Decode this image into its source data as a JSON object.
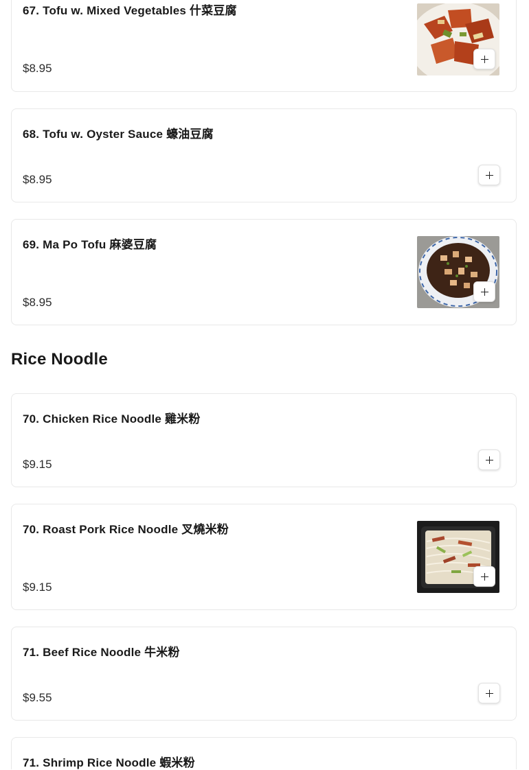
{
  "section": {
    "title": "Rice Noodle"
  },
  "items": [
    {
      "name": "67. Tofu w. Mixed Vegetables 什菜豆腐",
      "price": "$8.95",
      "add_label": "+"
    },
    {
      "name": "68. Tofu w. Oyster Sauce 蠔油豆腐",
      "price": "$8.95",
      "add_label": "+"
    },
    {
      "name": "69. Ma Po Tofu 麻婆豆腐",
      "price": "$8.95",
      "add_label": "+"
    },
    {
      "name": "70. Chicken Rice Noodle 雞米粉",
      "price": "$9.15",
      "add_label": "+"
    },
    {
      "name": "70. Roast Pork Rice Noodle 叉燒米粉",
      "price": "$9.15",
      "add_label": "+"
    },
    {
      "name": "71. Beef Rice Noodle 牛米粉",
      "price": "$9.55",
      "add_label": "+"
    },
    {
      "name": "71. Shrimp Rice Noodle 蝦米粉",
      "price": "",
      "add_label": "+"
    }
  ],
  "images": [
    {
      "icon": "tofu-mixed-vegetables-photo"
    },
    {
      "icon": "ma-po-tofu-photo"
    },
    {
      "icon": "roast-pork-rice-noodle-photo"
    }
  ]
}
